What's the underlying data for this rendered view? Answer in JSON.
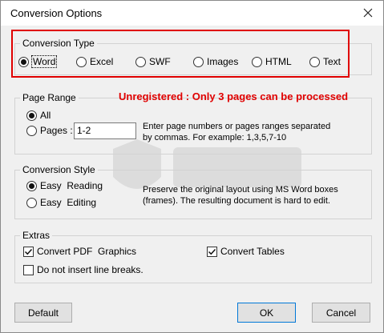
{
  "window": {
    "title": "Conversion Options"
  },
  "conversion_type": {
    "title": "Conversion Type",
    "options": [
      "Word",
      "Excel",
      "SWF",
      "Images",
      "HTML",
      "Text"
    ],
    "selected": "Word"
  },
  "page_range": {
    "title": "Page Range",
    "warning": "Unregistered : Only 3 pages can be processed",
    "all_label": "All",
    "pages_label": "Pages :",
    "pages_value": "1-2",
    "note_line1": "Enter page numbers or pages ranges separated",
    "note_line2": "by commas. For example: 1,3,5,7-10",
    "selected": "All"
  },
  "conversion_style": {
    "title": "Conversion Style",
    "easy_reading": "Easy  Reading",
    "easy_editing": "Easy  Editing",
    "note_line1": "Preserve the original layout using MS Word boxes",
    "note_line2": "(frames). The resulting document is hard to edit.",
    "selected": "Easy Reading"
  },
  "extras": {
    "title": "Extras",
    "convert_pdf_graphics": "Convert PDF  Graphics",
    "convert_tables": "Convert Tables",
    "no_line_breaks": "Do not insert line breaks.",
    "convert_pdf_graphics_checked": true,
    "convert_tables_checked": true,
    "no_line_breaks_checked": false
  },
  "buttons": {
    "default": "Default",
    "ok": "OK",
    "cancel": "Cancel"
  },
  "colors": {
    "warning": "#e00000",
    "highlight_frame": "#e00000"
  },
  "icons": {
    "close": "close-icon",
    "check": "check-icon"
  }
}
